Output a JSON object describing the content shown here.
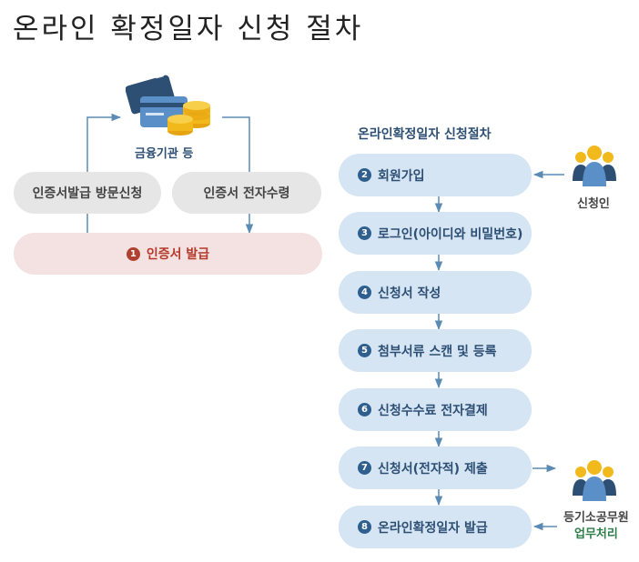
{
  "title": "온라인 확정일자 신청 절차",
  "left": {
    "institution_label": "금융기관 등",
    "visit_label": "인증서발급 방문신청",
    "receive_label": "인증서 전자수령",
    "issue": {
      "number": "1",
      "label": "인증서 발급"
    }
  },
  "right": {
    "heading": "온라인확정일자 신청절차",
    "steps": [
      {
        "number": "2",
        "label": "회원가입"
      },
      {
        "number": "3",
        "label": "로그인(아이디와 비밀번호)"
      },
      {
        "number": "4",
        "label": "신청서 작성"
      },
      {
        "number": "5",
        "label": "첨부서류 스캔 및 등록"
      },
      {
        "number": "6",
        "label": "신청수수료 전자결제"
      },
      {
        "number": "7",
        "label": "신청서(전자적) 제출"
      },
      {
        "number": "8",
        "label": "온라인확정일자 발급"
      }
    ],
    "applicant_label": "신청인",
    "officer_label": "등기소공무원",
    "officer_sub_label": "업무처리"
  },
  "colors": {
    "arrow": "#5b8bb5",
    "step_bg": "#d5e5f4",
    "step_text": "#2d4f74",
    "issue_bg": "#f4e1e1",
    "issue_text": "#b53a2c",
    "officer_sub_text": "#2e7d4a"
  }
}
